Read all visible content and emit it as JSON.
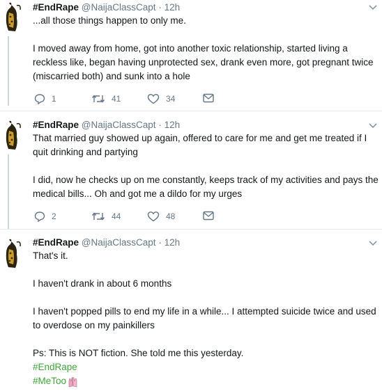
{
  "tweets": [
    {
      "display_name": "#EndRape",
      "handle": "@NaijaClassCapt",
      "time": "12h",
      "paragraphs": [
        "...all those things happen to only me.",
        "I moved away from home, got into another toxic relationship, started living a reckless like, began having unprotected sex, drank even more, got pregnant twice (miscarried both) and sunk into a hole"
      ],
      "replies": "1",
      "retweets": "41",
      "likes": "34"
    },
    {
      "display_name": "#EndRape",
      "handle": "@NaijaClassCapt",
      "time": "12h",
      "paragraphs": [
        "That married guy showed up again, offered to care for me and get me treated if I quit drinking and partying",
        "I did, now he checks up on me constantly, keeps track of my activities and pays the medical bills... Oh and got me a dildo for my urges"
      ],
      "replies": "2",
      "retweets": "44",
      "likes": "48"
    },
    {
      "display_name": "#EndRape",
      "handle": "@NaijaClassCapt",
      "time": "12h",
      "paragraphs": [
        "That's it.",
        "I haven't drank in about 6 months",
        "I haven't popped pills to end my life in a while... I attempted suicide twice and used to overdose on my painkillers",
        "Ps: This is NOT fiction. She told me this yesterday."
      ],
      "hashtags": [
        "#EndRape",
        "#MeToo"
      ]
    }
  ],
  "separator_dot": "·",
  "colors": {
    "hashtag": "#3fa63a",
    "muted": "#657786",
    "divider": "#e6ecf0",
    "thread_line": "#ccd6dd"
  },
  "icons": [
    "reply-icon",
    "retweet-icon",
    "like-icon",
    "dm-icon",
    "chevron-down-icon",
    "raised-hands-emoji"
  ]
}
